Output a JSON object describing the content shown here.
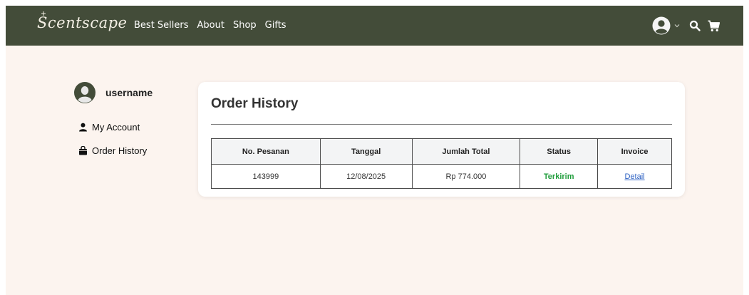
{
  "brand": {
    "name": "Scentscape"
  },
  "nav": {
    "links": [
      {
        "label": "Best Sellers"
      },
      {
        "label": "About"
      },
      {
        "label": "Shop"
      },
      {
        "label": "Gifts"
      }
    ]
  },
  "sidebar": {
    "username": "username",
    "items": [
      {
        "label": "My Account",
        "icon": "user-icon"
      },
      {
        "label": "Order History",
        "icon": "shopping-bag-icon"
      }
    ]
  },
  "main": {
    "title": "Order History",
    "table": {
      "headers": [
        "No. Pesanan",
        "Tanggal",
        "Jumlah Total",
        "Status",
        "Invoice"
      ],
      "rows": [
        {
          "order_no": "143999",
          "date": "12/08/2025",
          "total": "Rp 774.000",
          "status": "Terkirim",
          "invoice": "Detail"
        }
      ]
    }
  },
  "colors": {
    "navbar": "#434c39",
    "page_bg": "#fcf4ef",
    "status_ok": "#1e9c3a",
    "link": "#2a5fc2"
  }
}
